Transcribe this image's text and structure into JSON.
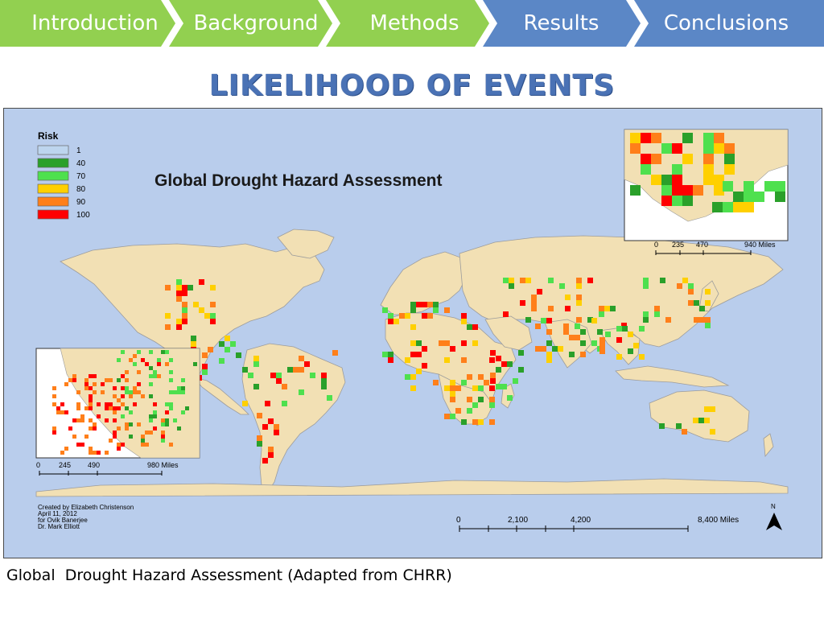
{
  "nav": {
    "items": [
      {
        "label": "Introduction",
        "color": "#92d050"
      },
      {
        "label": "Background",
        "color": "#92d050"
      },
      {
        "label": "Methods",
        "color": "#92d050"
      },
      {
        "label": "Results",
        "color": "#5b87c6"
      },
      {
        "label": "Conclusions",
        "color": "#5b87c6"
      }
    ]
  },
  "slide": {
    "title": "LIKELIHOOD OF EVENTS",
    "caption": "Global  Drought Hazard Assessment (Adapted from CHRR)"
  },
  "map": {
    "title": "Global Drought Hazard Assessment",
    "legend": {
      "heading": "Risk",
      "items": [
        {
          "label": "1",
          "color": "#bdd5ee"
        },
        {
          "label": "40",
          "color": "#2aa02a"
        },
        {
          "label": "70",
          "color": "#4ee04e"
        },
        {
          "label": "80",
          "color": "#ffd000"
        },
        {
          "label": "90",
          "color": "#ff7f1a"
        },
        {
          "label": "100",
          "color": "#ff0000"
        }
      ]
    },
    "scalebar_main": {
      "ticks": [
        "0",
        "2,100",
        "4,200",
        "8,400 Miles"
      ]
    },
    "scalebar_inset_asia": {
      "ticks": [
        "0",
        "235",
        "470",
        "940 Miles"
      ]
    },
    "scalebar_inset_us": {
      "ticks": [
        "0",
        "245",
        "490",
        "980 Miles"
      ]
    },
    "credits": [
      "Created by Elizabeth Christenson",
      "April 11, 2012",
      "for Ovik Banerjee",
      "Dr. Mark Elliott"
    ],
    "north_label": "N",
    "colors": {
      "ocean": "#b9cdec",
      "land": "#f2e0b4",
      "border": "#9c9c9c"
    }
  }
}
